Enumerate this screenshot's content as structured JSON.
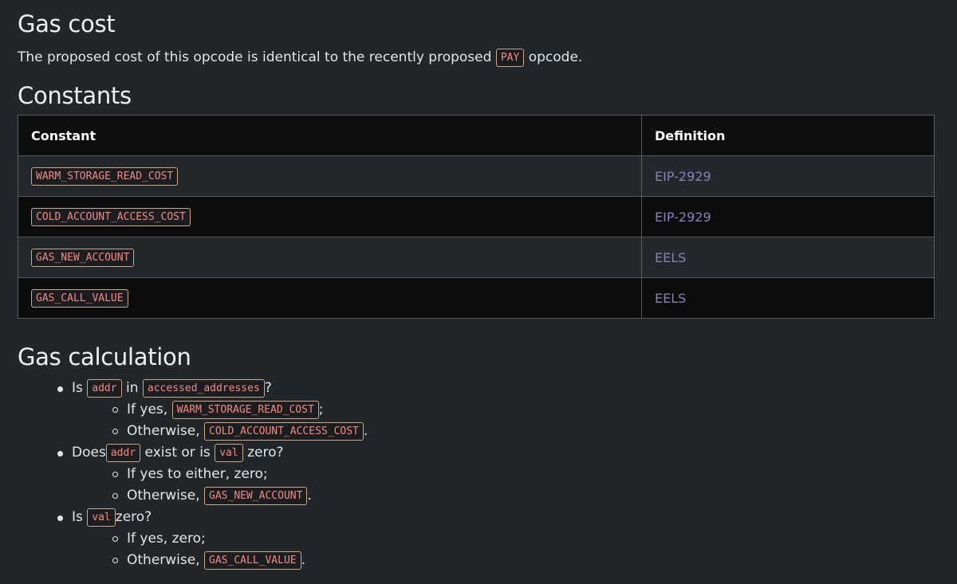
{
  "headings": {
    "gas_cost": "Gas cost",
    "constants": "Constants",
    "gas_calculation": "Gas calculation"
  },
  "intro": {
    "before": "The proposed cost of this opcode is identical to the recently proposed",
    "code": "PAY",
    "after": "opcode."
  },
  "table": {
    "columns": [
      "Constant",
      "Definition"
    ],
    "rows": [
      {
        "constant": "WARM_STORAGE_READ_COST",
        "definition": "EIP-2929"
      },
      {
        "constant": "COLD_ACCOUNT_ACCESS_COST",
        "definition": "EIP-2929"
      },
      {
        "constant": "GAS_NEW_ACCOUNT",
        "definition": "EELS"
      },
      {
        "constant": "GAS_CALL_VALUE",
        "definition": "EELS"
      }
    ]
  },
  "calc": {
    "item1": {
      "t1": "Is",
      "c1": "addr",
      "t2": "in",
      "c2": "accessed_addresses",
      "t3": "?",
      "sub1": {
        "t1": "If yes,",
        "c1": "WARM_STORAGE_READ_COST",
        "t2": ";"
      },
      "sub2": {
        "t1": "Otherwise,",
        "c1": "COLD_ACCOUNT_ACCESS_COST",
        "t2": "."
      }
    },
    "item2": {
      "t1": "Does",
      "c1": "addr",
      "t2": "exist or is",
      "c2": "val",
      "t3": "zero?",
      "sub1": {
        "t1": "If yes to either, zero;"
      },
      "sub2": {
        "t1": "Otherwise,",
        "c1": "GAS_NEW_ACCOUNT",
        "t2": "."
      }
    },
    "item3": {
      "t1": "Is",
      "c1": "val",
      "t2": "zero?",
      "sub1": {
        "t1": "If yes, zero;"
      },
      "sub2": {
        "t1": "Otherwise,",
        "c1": "GAS_CALL_VALUE",
        "t2": "."
      }
    }
  },
  "colors": {
    "background": "#22252a",
    "code_text": "#f28b82",
    "link": "#8d7fb9"
  }
}
